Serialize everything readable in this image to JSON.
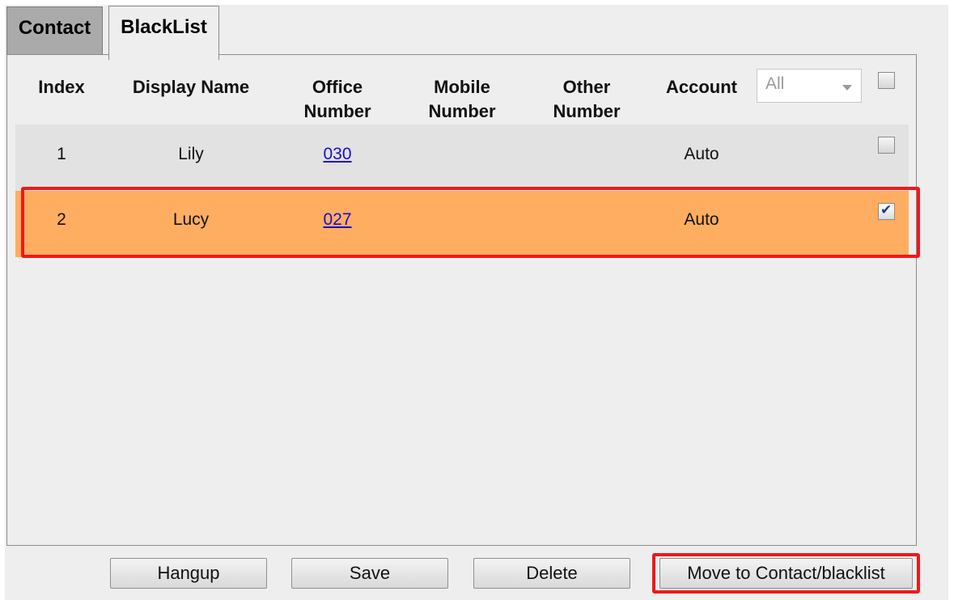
{
  "tabs": [
    {
      "label": "Contact",
      "active": false
    },
    {
      "label": "BlackList",
      "active": true
    }
  ],
  "table": {
    "headers": {
      "index": "Index",
      "display_name": "Display Name",
      "office_1": "Office",
      "office_2": "Number",
      "mobile_1": "Mobile",
      "mobile_2": "Number",
      "other_1": "Other",
      "other_2": "Number",
      "account": "Account"
    },
    "account_filter": {
      "selected": "All"
    },
    "select_all_checked": false,
    "rows": [
      {
        "index": "1",
        "display_name": "Lily",
        "office": "030",
        "mobile": "",
        "other": "",
        "account": "Auto",
        "checked": false
      },
      {
        "index": "2",
        "display_name": "Lucy",
        "office": "027",
        "mobile": "",
        "other": "",
        "account": "Auto",
        "checked": true
      }
    ]
  },
  "buttons": {
    "hangup": "Hangup",
    "save": "Save",
    "delete": "Delete",
    "move": "Move to Contact/blacklist"
  },
  "colors": {
    "selected_row": "#ffad60",
    "highlight_border": "#f0181c",
    "link": "#1a0dcc"
  }
}
